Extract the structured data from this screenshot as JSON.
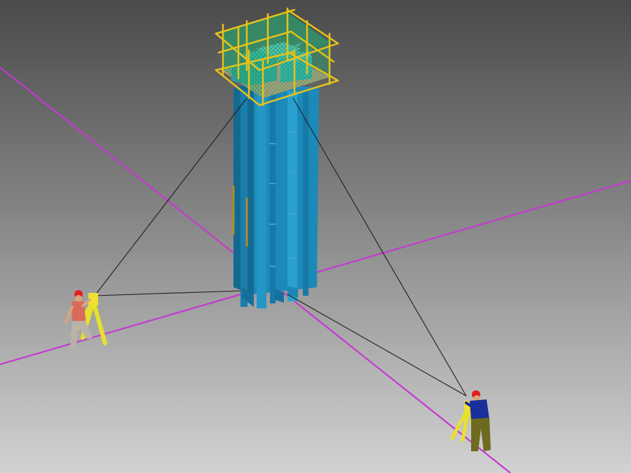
{
  "scene": {
    "colors": {
      "background_top": "#4a4a4a",
      "background_mid": "#858585",
      "background_bottom": "#d2d2d2",
      "axis_line": "#c43ad0",
      "sight_line": "#1e1e1e",
      "column_body": "#1c8ab8",
      "column_shadow": "#136a91",
      "column_highlight": "#3aa6d2",
      "rebar": "#b08a2a",
      "scaffold_pipe": "#e6c21a",
      "safety_net": "#2db37a",
      "formwork_platform": "#e89a78",
      "inner_formwork": "#3ec0c8",
      "cross_brace": "#7fd4f0",
      "hardhat": "#e02020",
      "worker_left_shirt": "#d96a5a",
      "worker_right_shirt": "#1a2e9c",
      "worker_right_trousers": "#6e6a20",
      "worker_left_trousers": "#b8b2a8",
      "skin": "#d9a57c",
      "tripod_leg": "#e8e02a",
      "instrument": "#f0e030"
    },
    "icons": {
      "column": "concrete-column-icon",
      "scaffold": "scaffold-platform-icon",
      "surveyor": "surveyor-with-theodolite-icon"
    }
  }
}
